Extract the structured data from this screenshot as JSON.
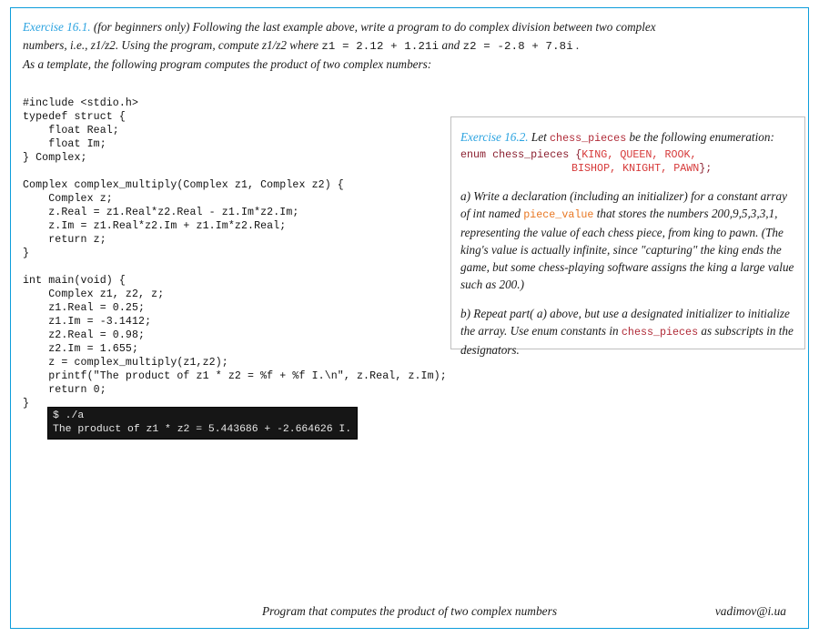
{
  "frame": {
    "border_color": "#0d9ddb"
  },
  "intro": {
    "exercise_label": "Exercise 16.1.",
    "line1_a": " (for beginners only) Following the last example above, write a program to do complex division between two complex",
    "line2_a": "numbers, i.e., z1/z2. Using the program, compute z1/z2 where ",
    "line2_code1": "z1 = 2.12 + 1.21i",
    "line2_b": " and ",
    "line2_code2": "z2 = -2.8 + 7.8i",
    "line2_c": " .",
    "line3": "As a template, the following program computes the product of two complex numbers:"
  },
  "code": {
    "text": "#include <stdio.h>\ntypedef struct {\n    float Real;\n    float Im;\n} Complex;\n\nComplex complex_multiply(Complex z1, Complex z2) {\n    Complex z;\n    z.Real = z1.Real*z2.Real - z1.Im*z2.Im;\n    z.Im = z1.Real*z2.Im + z1.Im*z2.Real;\n    return z;\n}\n\nint main(void) {\n    Complex z1, z2, z;\n    z1.Real = 0.25;\n    z1.Im = -3.1412;\n    z2.Real = 0.98;\n    z2.Im = 1.655;\n    z = complex_multiply(z1,z2);\n    printf(\"The product of z1 * z2 = %f + %f I.\\n\", z.Real, z.Im);\n    return 0;\n}"
  },
  "terminal": {
    "background": "#161616",
    "text_color": "#e8e8e8",
    "line1": "$ ./a",
    "line2": "The product of z1 * z2 = 5.443686 + -2.664626 I."
  },
  "side_box": {
    "border_color": "#bfbfbf",
    "exercise_label": "Exercise 16.2.",
    "head_a": " Let ",
    "head_code": "chess_pieces",
    "head_b": " be the following enumeration:",
    "enum_line1_a": "enum chess_pieces {",
    "enum_line1_b": "KING, QUEEN, ROOK,",
    "enum_line2_a": "BISHOP, KNIGHT, PAWN",
    "enum_line2_b": "};",
    "part_a_1": "a) Write a declaration (including an initializer) for a constant array of int named ",
    "part_a_code": "piece_value",
    "part_a_2": " that stores the numbers 200,9,5,3,3,1, representing the value of each chess piece, from king to pawn. (The king's value is actually infinite, since \"capturing\" the king ends the game, but some chess-playing software assigns the king a large value such as 200.)",
    "part_b_1": "b) Repeat part( a) above, but use a designated initializer to initialize the array. Use enum constants in ",
    "part_b_code": "chess_pieces",
    "part_b_2": " as subscripts in the designators."
  },
  "footer": {
    "caption": "Program that computes the product of two complex numbers",
    "email": "vadimov@i.ua"
  }
}
